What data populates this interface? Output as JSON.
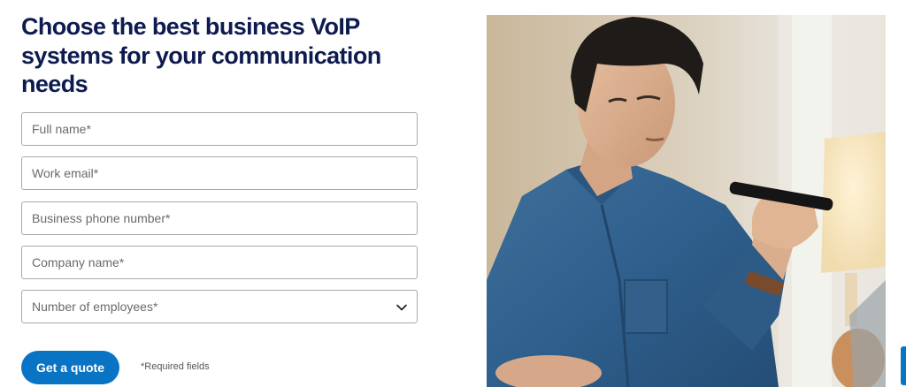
{
  "headline": "Choose the best business VoIP systems for your communication needs",
  "form": {
    "full_name_placeholder": "Full name*",
    "work_email_placeholder": "Work email*",
    "phone_placeholder": "Business phone number*",
    "company_placeholder": "Company name*",
    "employees_select": {
      "selected": "Number of employees*"
    },
    "submit_label": "Get a quote",
    "required_note": "*Required fields"
  },
  "colors": {
    "headline": "#0d1b4f",
    "button": "#0a74c4",
    "field_border": "#a8a8a8"
  },
  "icons": {
    "select_arrow": "chevron-down-icon"
  },
  "image": {
    "subject": "man in denim shirt speaking into a smartphone"
  }
}
